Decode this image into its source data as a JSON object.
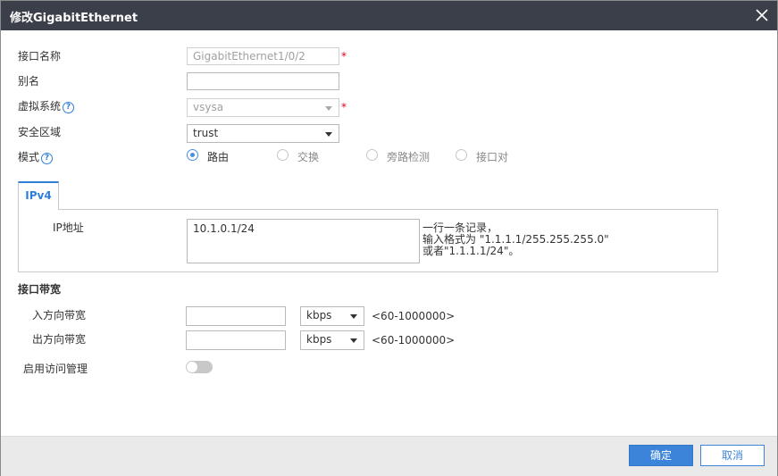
{
  "dialog": {
    "title": "修改GigabitEthernet",
    "close_icon": "close-icon"
  },
  "form": {
    "interface_name": {
      "label": "接口名称",
      "value": "GigabitEthernet1/0/2",
      "required": "*"
    },
    "alias": {
      "label": "别名",
      "value": ""
    },
    "virtual_system": {
      "label": "虚拟系统",
      "value": "vsysa",
      "required": "*",
      "help": "?"
    },
    "security_zone": {
      "label": "安全区域",
      "value": "trust"
    },
    "mode": {
      "label": "模式",
      "help": "?",
      "options": [
        {
          "label": "路由",
          "selected": true
        },
        {
          "label": "交换",
          "selected": false
        },
        {
          "label": "旁路检测",
          "selected": false
        },
        {
          "label": "接口对",
          "selected": false
        }
      ]
    }
  },
  "ipv4": {
    "tab_label": "IPv4",
    "ip_label": "IP地址",
    "ip_value": "10.1.0.1/24",
    "hint_lines": [
      "一行一条记录，",
      "输入格式为 \"1.1.1.1/255.255.255.0\"",
      "或者\"1.1.1.1/24\"。"
    ]
  },
  "bandwidth": {
    "section_title": "接口带宽",
    "inbound": {
      "label": "入方向带宽",
      "value": "",
      "unit": "kbps",
      "range": "<60-1000000>"
    },
    "outbound": {
      "label": "出方向带宽",
      "value": "",
      "unit": "kbps",
      "range": "<60-1000000>"
    }
  },
  "access_mgmt": {
    "label": "启用访问管理",
    "enabled": false
  },
  "footer": {
    "confirm_label": "确定",
    "cancel_label": "取消"
  },
  "colors": {
    "titlebar": "#3b3f4a",
    "accent": "#3c84d9",
    "required": "#e0001b",
    "footer": "#eaeaea"
  }
}
